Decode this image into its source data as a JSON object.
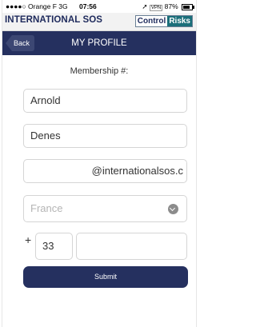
{
  "status_bar": {
    "carrier": "●●●●○ Orange F  3G",
    "time": "07:56",
    "vpn": "VPN",
    "battery": "87%"
  },
  "brand": {
    "left": "INTERNATIONAL SOS",
    "right_part1": "Control",
    "right_part2": "Risks"
  },
  "nav": {
    "back_label": "Back",
    "title": "MY PROFILE"
  },
  "form": {
    "membership_label": "Membership #:",
    "first_name": "Arnold",
    "last_name": "Denes",
    "email": "@internationalsos.c",
    "country": "France",
    "phone_prefix": "+",
    "country_code": "33",
    "phone_number": "",
    "submit_label": "Submit"
  }
}
